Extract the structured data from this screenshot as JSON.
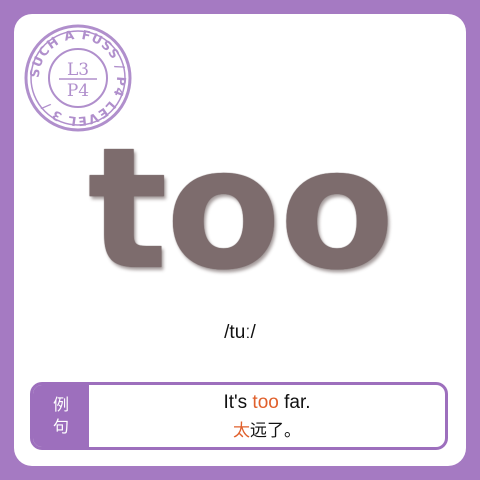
{
  "stamp": {
    "ring_text": "SUCH A FUSS / P4 LEVEL 3 /",
    "center_top": "L3",
    "center_bottom": "P4",
    "color": "#b08fcc"
  },
  "word": "too",
  "phonetic": "/tuː/",
  "example": {
    "tag_line1": "例",
    "tag_line2": "句",
    "en_before": "It's ",
    "en_highlight": "too",
    "en_after": " far.",
    "zh_highlight": "太",
    "zh_after": "远了。"
  },
  "colors": {
    "frame": "#a57ac2",
    "accent": "#9d6fbd",
    "word": "#7d6c6d",
    "highlight": "#e0602c"
  }
}
